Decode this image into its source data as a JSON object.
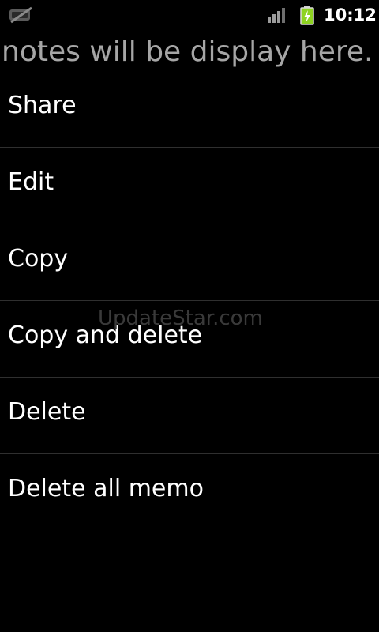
{
  "status_bar": {
    "time": "10:12",
    "left_icon": "notification-muted-icon",
    "signal_icon": "signal-icon",
    "battery_icon": "battery-charging-icon"
  },
  "background": {
    "notes_hint": "notes will be display here."
  },
  "menu": {
    "items": [
      {
        "label": "Share"
      },
      {
        "label": "Edit"
      },
      {
        "label": "Copy"
      },
      {
        "label": "Copy and delete"
      },
      {
        "label": "Delete"
      },
      {
        "label": "Delete all memo"
      }
    ]
  },
  "watermark": "UpdateStar.com",
  "colors": {
    "background": "#000000",
    "text": "#ffffff",
    "hint_text": "#a6a6a6",
    "divider": "#2f2f2f",
    "battery": "#8ed321"
  }
}
